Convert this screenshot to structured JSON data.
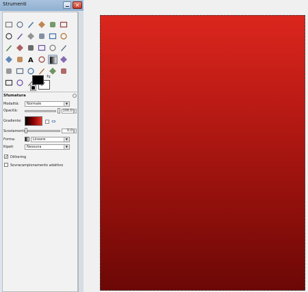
{
  "window": {
    "title": "Strumenti",
    "close_glyph": "×"
  },
  "tools": [
    "rect-select-icon",
    "ellipse-select-icon",
    "free-select-icon",
    "fuzzy-select-icon",
    "color-select-icon",
    "scissors-select-icon",
    "foreground-select-icon",
    "paths-icon",
    "color-picker-icon",
    "zoom-icon",
    "measure-icon",
    "move-icon",
    "align-icon",
    "crop-icon",
    "rotate-icon",
    "scale-icon",
    "shear-icon",
    "perspective-icon",
    "flip-icon",
    "cage-icon",
    "text-icon",
    "bucket-fill-icon",
    "blend-icon",
    "pencil-icon",
    "paintbrush-icon",
    "eraser-icon",
    "airbrush-icon",
    "ink-icon",
    "clone-icon",
    "heal-icon",
    "perspective-clone-icon",
    "blur-icon",
    "smudge-icon",
    "dodge-burn-icon"
  ],
  "colors": {
    "foreground": "#000000",
    "background": "#ffffff",
    "swap_glyph": "⇆"
  },
  "options": {
    "title": "Sfumatura",
    "mode_label": "Modalità:",
    "mode_value": "Normale",
    "opacity_label": "Opacità:",
    "opacity_value": "100,0",
    "gradient_label": "Gradiente:",
    "gradient_reverse_glyph": "⇔",
    "offset_label": "Scostamento:",
    "offset_value": "0,0",
    "shape_label": "Forma:",
    "shape_value": "Lineare",
    "repeat_label": "Ripeti",
    "repeat_value": "Nessuna",
    "dithering_label": "Dithering",
    "dithering_checked": true,
    "supersample_label": "Sovracampionamento adattivo",
    "supersample_checked": false,
    "check_glyph": "✓",
    "dropdown_glyph": "▼"
  },
  "canvas": {
    "top_color": "#db261d",
    "bottom_color": "#6b0806"
  }
}
